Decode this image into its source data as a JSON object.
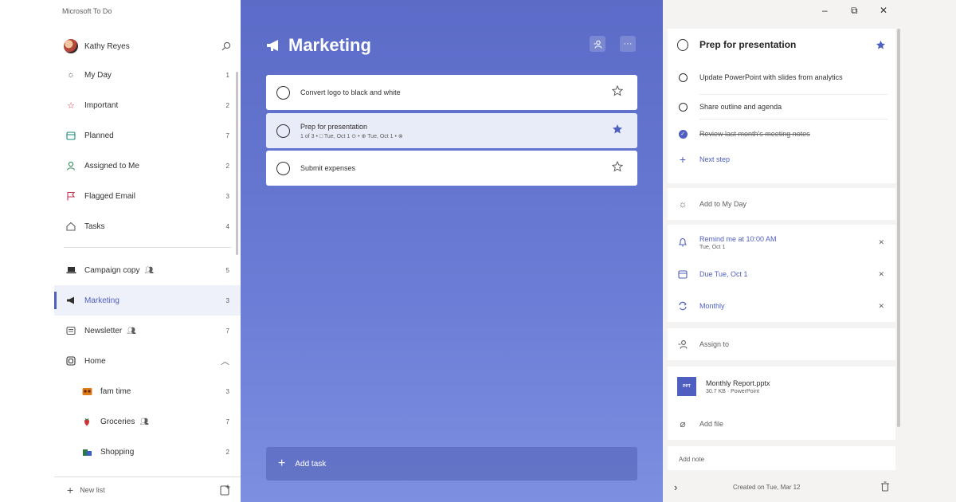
{
  "app": {
    "title": "Microsoft To Do"
  },
  "profile": {
    "name": "Kathy Reyes"
  },
  "nav": {
    "smart_lists": [
      {
        "label": "My Day",
        "count": "1",
        "icon": "sun-icon"
      },
      {
        "label": "Important",
        "count": "2",
        "icon": "star-icon"
      },
      {
        "label": "Planned",
        "count": "7",
        "icon": "calendar-icon"
      },
      {
        "label": "Assigned to Me",
        "count": "2",
        "icon": "person-icon"
      },
      {
        "label": "Flagged Email",
        "count": "3",
        "icon": "flag-icon"
      },
      {
        "label": "Tasks",
        "count": "4",
        "icon": "home-icon"
      }
    ],
    "lists": [
      {
        "label": "Campaign copy",
        "count": "5",
        "shared": true
      },
      {
        "label": "Marketing",
        "count": "3",
        "active": true
      },
      {
        "label": "Newsletter",
        "count": "7",
        "shared": true
      },
      {
        "label": "Home",
        "group": true
      }
    ],
    "group_lists": [
      {
        "label": "fam time",
        "count": "3"
      },
      {
        "label": "Groceries",
        "count": "7",
        "shared": true
      },
      {
        "label": "Shopping",
        "count": "2"
      }
    ],
    "new_list_label": "New list"
  },
  "main": {
    "list_title": "Marketing",
    "tasks": [
      {
        "title": "Convert logo to black and white",
        "meta": "",
        "important": false
      },
      {
        "title": "Prep for presentation",
        "meta": "1 of 3  •  □ Tue, Oct 1  ⊙  •  ⊕ Tue, Oct 1  •  ⊗",
        "important": true
      },
      {
        "title": "Submit expenses",
        "meta": "",
        "important": false
      }
    ],
    "add_task_label": "Add task"
  },
  "detail": {
    "title": "Prep for presentation",
    "important": true,
    "steps": [
      {
        "label": "Update PowerPoint with slides from analytics",
        "done": false
      },
      {
        "label": "Share outline and agenda",
        "done": false
      },
      {
        "label": "Review last month's meeting notes",
        "done": true
      }
    ],
    "next_step_label": "Next step",
    "add_my_day_label": "Add to My Day",
    "reminder": {
      "label": "Remind me at 10:00 AM",
      "sub": "Tue, Oct 1"
    },
    "due_label": "Due Tue, Oct 1",
    "repeat_label": "Monthly",
    "assign_label": "Assign to",
    "file": {
      "name": "Monthly Report.pptx",
      "sub": "30.7 KB · PowerPoint",
      "badge": "PPT"
    },
    "add_file_label": "Add file",
    "add_note_label": "Add note",
    "created_label": "Created on Tue, Mar 12"
  },
  "colors": {
    "accent": "#4f5fbf",
    "main_bg": "#5b6bc7"
  }
}
